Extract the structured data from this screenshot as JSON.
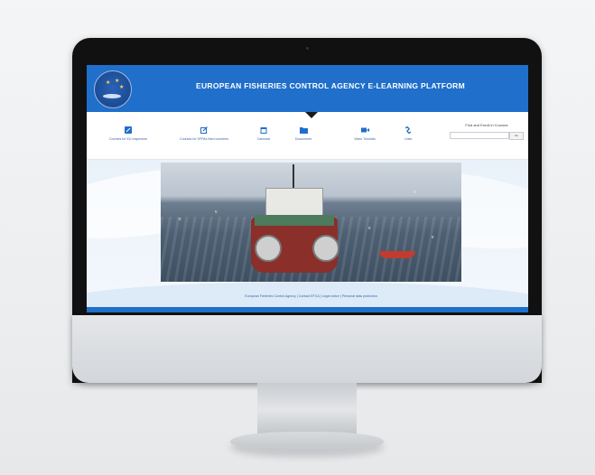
{
  "site": {
    "title": "EUROPEAN FISHERIES CONTROL AGENCY E-LEARNING PLATFORM",
    "brand_color": "#1f6fcb"
  },
  "nav": {
    "items": [
      {
        "label": "Courses for EU Inspectors",
        "icon": "edit-square-icon"
      },
      {
        "label": "Courses for SFPAs third countries",
        "icon": "pencil-square-icon"
      },
      {
        "label": "Calendar",
        "icon": "calendar-icon"
      },
      {
        "label": "Documents",
        "icon": "folder-icon"
      },
      {
        "label": "Video Tutorials",
        "icon": "video-camera-icon"
      },
      {
        "label": "Links",
        "icon": "link-icon"
      }
    ]
  },
  "search": {
    "label": "Find and Enroll in Courses",
    "placeholder": "",
    "button_label": "Go"
  },
  "footer": {
    "text": "European Fisheries Control Agency | Contact EFCA | Legal notice | Personal data protection"
  }
}
